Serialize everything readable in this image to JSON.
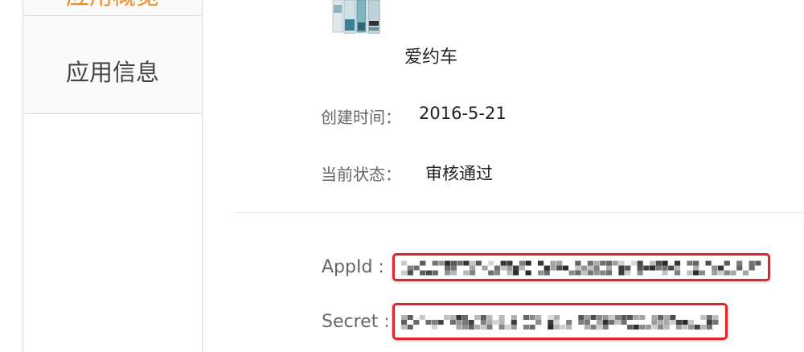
{
  "sidebar": {
    "items": [
      {
        "label": "应用概览",
        "active": true
      },
      {
        "label": "应用信息",
        "active": false
      }
    ]
  },
  "app": {
    "name": "爱约车",
    "icon": "skincare-products-icon"
  },
  "details": {
    "created_label": "创建时间：",
    "created_value": "2016-5-21",
    "status_label": "当前状态：",
    "status_value": "审核通过"
  },
  "credentials": {
    "appid_label": "AppId :",
    "secret_label": "Secret :"
  },
  "colors": {
    "accent": "#f08a1e",
    "highlight_border": "#e0242a",
    "divider": "#dcdcdc"
  }
}
